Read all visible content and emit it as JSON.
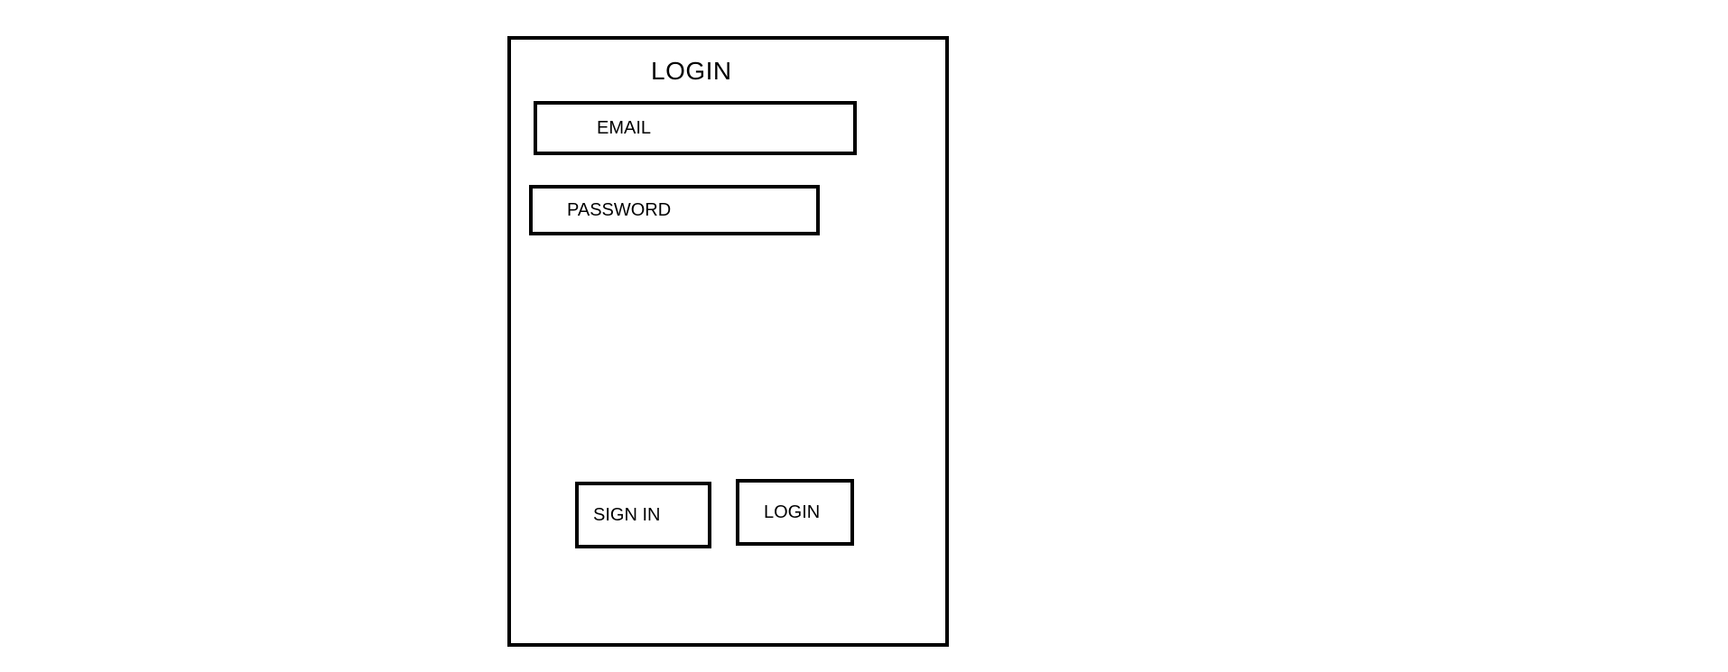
{
  "login_panel": {
    "title": "LOGIN"
  },
  "fields": {
    "email_label": "EMAIL",
    "password_label": "PASSWORD"
  },
  "actions": {
    "sign_in_label": "SIGN IN",
    "login_label": "LOGIN"
  }
}
